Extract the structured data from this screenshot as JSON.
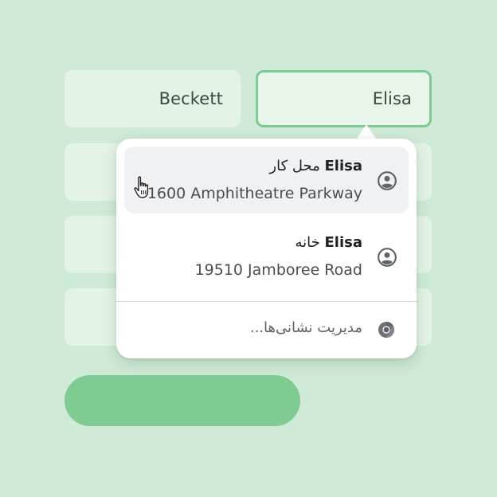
{
  "form": {
    "last_name_value": "Beckett",
    "first_name_value": "Elisa"
  },
  "autofill": {
    "suggestions": [
      {
        "name": "Elisa",
        "label": "محل کار",
        "address": "1600 Amphitheatre Parkway",
        "icon": "person-icon"
      },
      {
        "name": "Elisa",
        "label": "خانه",
        "address": "19510 Jamboree Road",
        "icon": "person-icon"
      }
    ],
    "manage_label": "مدیریت نشانی‌ها...",
    "manage_icon": "chrome-icon"
  },
  "colors": {
    "background": "#cfead6",
    "field": "#e3f3e6",
    "focus_border": "#7dcb93",
    "button": "#7fcb92"
  }
}
